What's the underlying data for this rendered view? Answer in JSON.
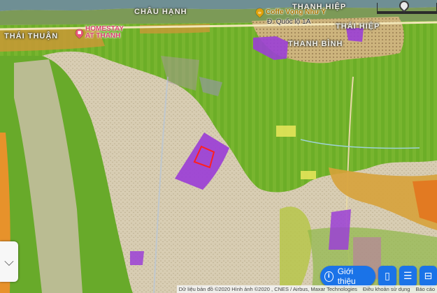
{
  "map": {
    "places": [
      {
        "id": "chau-hanh",
        "name": "CHÂU HẠNH"
      },
      {
        "id": "thanh-hiep",
        "name": "THẠNH HIỆP"
      },
      {
        "id": "thai-thuan",
        "name": "THÁI THUẬN"
      },
      {
        "id": "thai-hiep",
        "name": "THÁI HIỆP"
      },
      {
        "id": "thanh-binh",
        "name": "THANH BÌNH"
      }
    ],
    "pois": [
      {
        "id": "homestay",
        "line1": "HOMESTAY",
        "line2": "AT THANH",
        "color": "#e8557a"
      },
      {
        "id": "coffee",
        "line1": "Coffe Vọng Như Ý",
        "color": "#e0a10a"
      }
    ],
    "roads": [
      {
        "id": "ql1a",
        "name": "Đ. Quốc lộ 1A"
      }
    ],
    "colors": {
      "green_zone": "#5aa31e",
      "residential": "#c8a445",
      "purple_zone": "#9b3fd6",
      "water": "#6f8f94",
      "highlight": "#ff1f1f"
    }
  },
  "controls": {
    "intro_label": "Giới thiệu",
    "icons": [
      "document-icon",
      "list-document-icon",
      "book-icon"
    ]
  },
  "attribution": {
    "data": "Dữ liệu bản đồ ©2020 Hình ảnh ©2020 , CNES / Airbus, Maxar Technologies",
    "terms": "Điều khoản sử dụng",
    "report": "Báo cáo"
  }
}
